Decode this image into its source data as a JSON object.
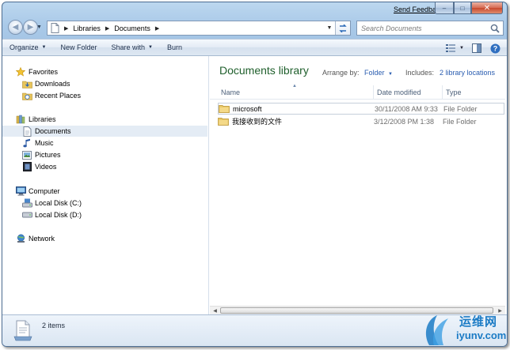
{
  "window": {
    "feedback_link": "Send Feedback",
    "caption_buttons": {
      "minimize": "–",
      "maximize": "□",
      "close": "✕"
    }
  },
  "address": {
    "crumbs": [
      "Libraries",
      "Documents"
    ],
    "search_placeholder": "Search Documents"
  },
  "commands": {
    "organize": "Organize",
    "new_folder": "New Folder",
    "share_with": "Share with",
    "burn": "Burn"
  },
  "navpane": {
    "favorites": "Favorites",
    "downloads": "Downloads",
    "recent_places": "Recent Places",
    "libraries": "Libraries",
    "documents": "Documents",
    "music": "Music",
    "pictures": "Pictures",
    "videos": "Videos",
    "computer": "Computer",
    "local_disk_c": "Local Disk (C:)",
    "local_disk_d": "Local Disk (D:)",
    "network": "Network"
  },
  "library": {
    "title": "Documents library",
    "arrange_label": "Arrange by:",
    "arrange_value": "Folder",
    "includes_label": "Includes:",
    "includes_value": "2 library locations"
  },
  "columns": {
    "name": "Name",
    "date": "Date modified",
    "type": "Type"
  },
  "files": [
    {
      "name": "microsoft",
      "date": "30/11/2008 AM 9:33",
      "type": "File Folder"
    },
    {
      "name": "我接收到的文件",
      "date": "3/12/2008 PM 1:38",
      "type": "File Folder"
    }
  ],
  "details": {
    "count": "2 items"
  },
  "watermark": {
    "line1": "运维网",
    "line2": "iyunv.com"
  },
  "colors": {
    "library_title": "#1f5f2c",
    "link": "#2a5db0",
    "frame": "#a9c9e8"
  }
}
